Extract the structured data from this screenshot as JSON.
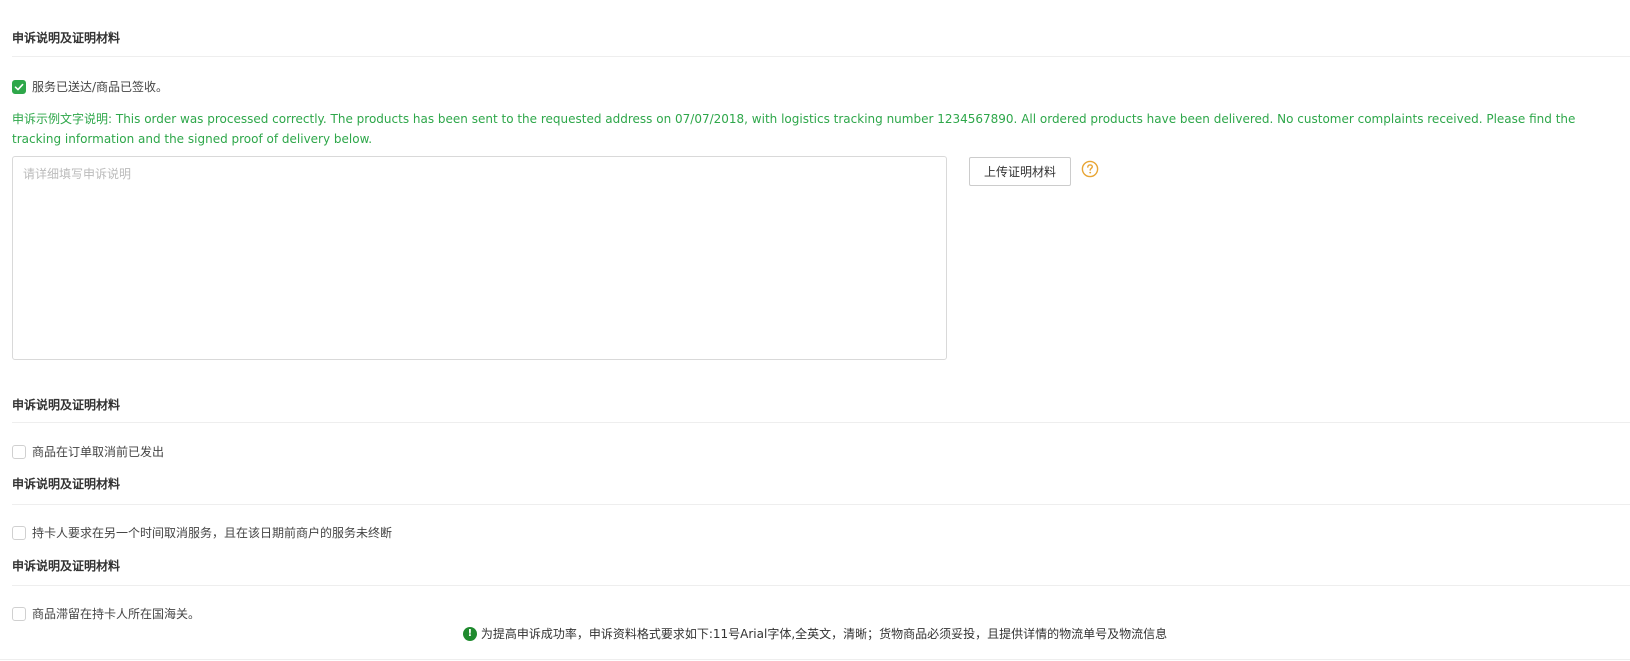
{
  "sections": [
    {
      "title": "申诉说明及证明材料",
      "checkbox_label": "服务已送达/商品已签收。",
      "checked": true,
      "example_prefix": "申诉示例文字说明:",
      "example_body": " This order was processed correctly. The products has been sent to the requested address on 07/07/2018, with logistics tracking number 1234567890. All ordered products have been delivered. No customer complaints received. Please find the tracking information and the signed proof of delivery below.",
      "textarea_placeholder": "请详细填写申诉说明",
      "textarea_value": "",
      "upload_label": "上传证明材料",
      "help_icon": "question-circle-icon"
    },
    {
      "title": "申诉说明及证明材料",
      "checkbox_label": "商品在订单取消前已发出",
      "checked": false
    },
    {
      "title": "申诉说明及证明材料",
      "checkbox_label": "持卡人要求在另一个时间取消服务，且在该日期前商户的服务未终断",
      "checked": false
    },
    {
      "title": "申诉说明及证明材料",
      "checkbox_label": "商品滞留在持卡人所在国海关。",
      "checked": false
    }
  ],
  "notice": {
    "icon": "exclamation-circle-icon",
    "text": "为提高申诉成功率，申诉资料格式要求如下:11号Arial字体,全英文，清晰；货物商品必须妥投，且提供详情的物流单号及物流信息"
  },
  "colors": {
    "accent_green": "#2ea74a",
    "notice_icon_green": "#1f8a2e",
    "help_icon_orange": "#e8a534"
  }
}
